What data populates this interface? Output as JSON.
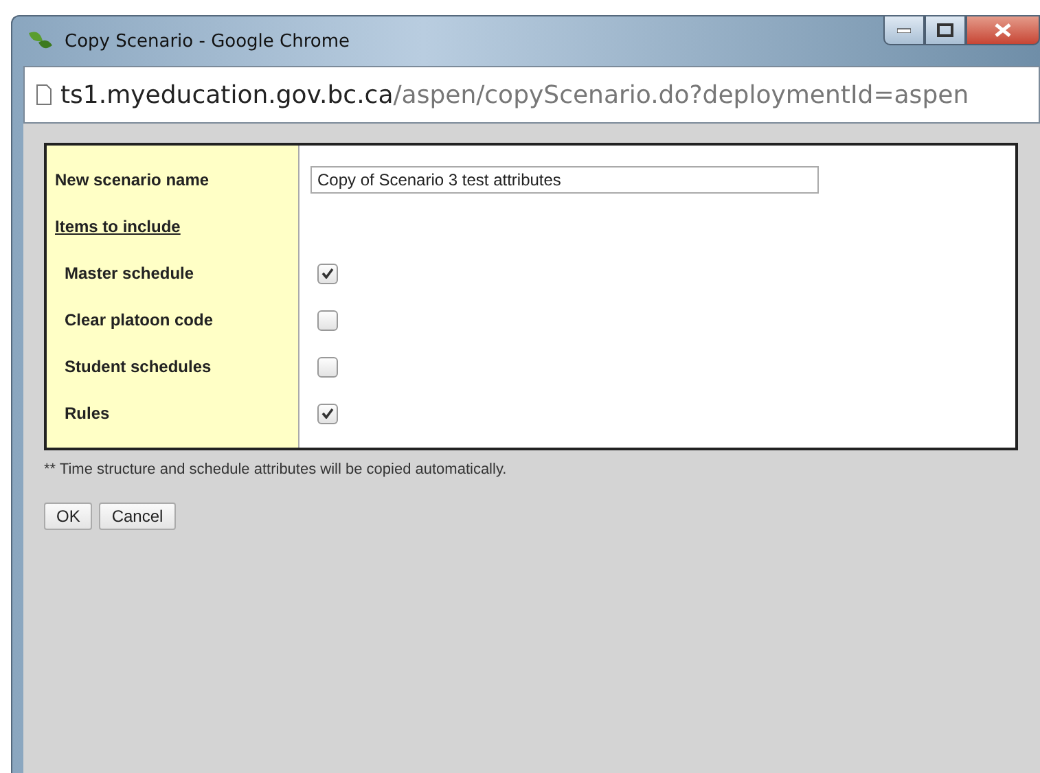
{
  "window": {
    "title": "Copy Scenario - Google Chrome"
  },
  "address_bar": {
    "host": "ts1.myeducation.gov.bc.ca",
    "path": "/aspen/copyScenario.do?deploymentId=aspen"
  },
  "form": {
    "name_label": "New scenario name",
    "name_value": "Copy of Scenario 3 test attributes",
    "section_label": "Items to include",
    "items": [
      {
        "label": "Master schedule",
        "checked": true
      },
      {
        "label": "Clear platoon code",
        "checked": false
      },
      {
        "label": "Student schedules",
        "checked": false
      },
      {
        "label": "Rules",
        "checked": true
      }
    ]
  },
  "note": "** Time structure and schedule attributes will be copied automatically.",
  "buttons": [
    "OK",
    "Cancel"
  ]
}
